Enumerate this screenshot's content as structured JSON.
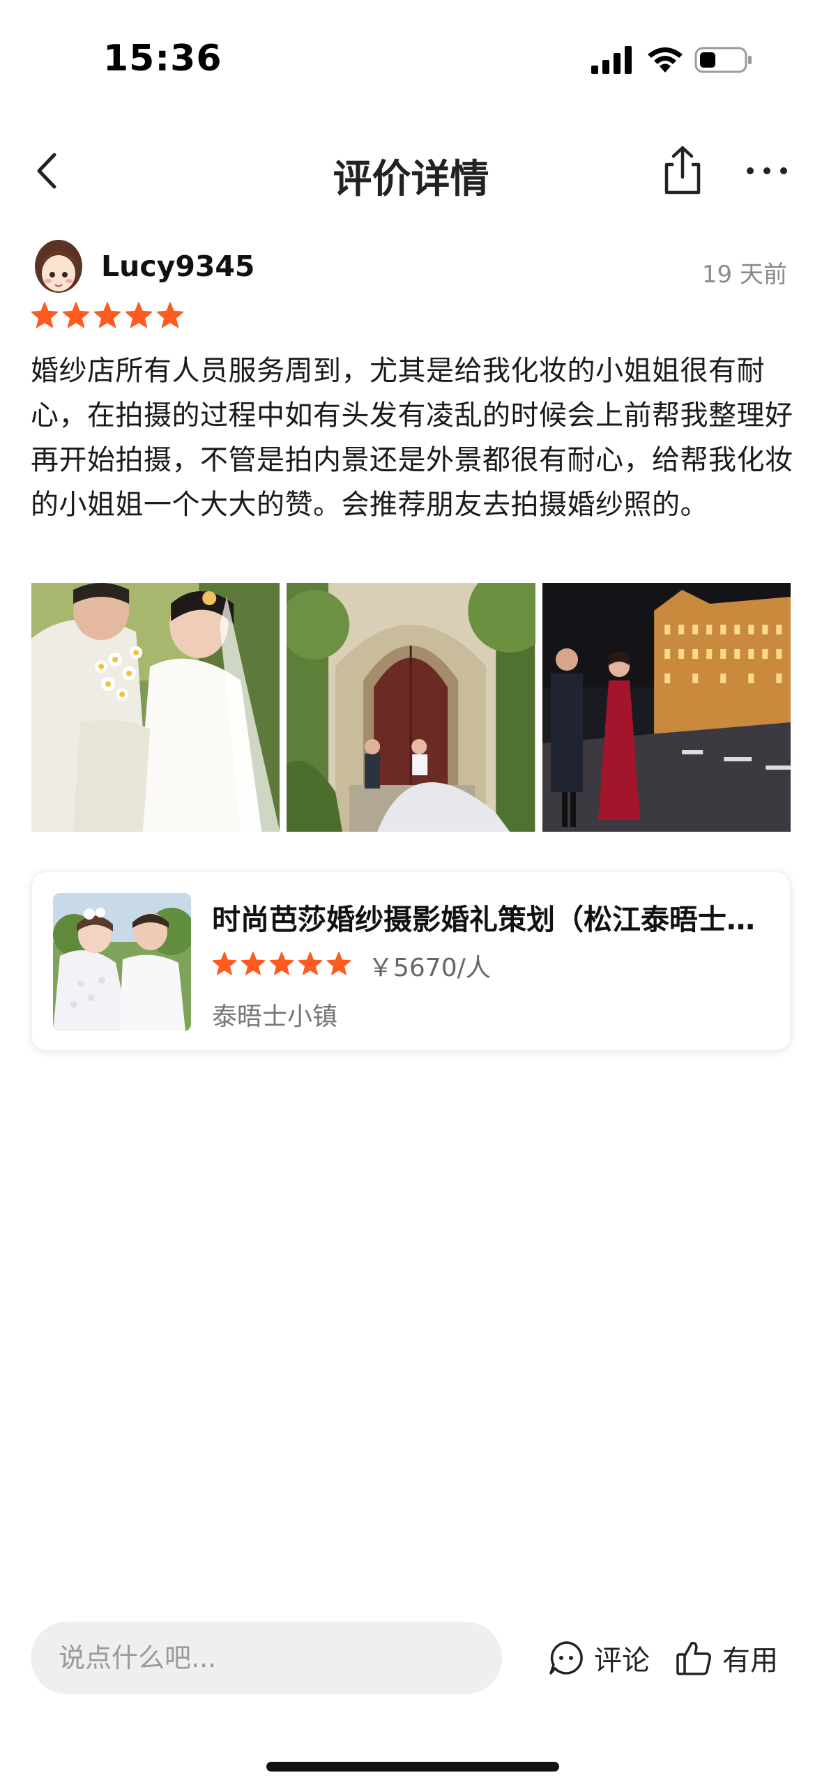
{
  "status_bar": {
    "time": "15:36",
    "icons": [
      "signal-icon",
      "wifi-icon",
      "battery-icon"
    ]
  },
  "nav": {
    "title": "评价详情",
    "back_icon": "chevron-left-icon",
    "share_icon": "share-icon",
    "more_icon": "more-icon"
  },
  "review": {
    "username": "Lucy9345",
    "time_ago": "19 天前",
    "rating": 5,
    "text": "婚纱店所有人员服务周到，尤其是给我化妆的小姐姐很有耐心，在拍摄的过程中如有头发有凌乱的时候会上前帮我整理好再开始拍摄，不管是拍内景还是外景都很有耐心，给帮我化妆的小姐姐一个大大的赞。会推荐朋友去拍摄婚纱照的。",
    "photos": [
      "wedding-photo-couple-flowers",
      "wedding-photo-church-door",
      "wedding-photo-night-street"
    ]
  },
  "product": {
    "title": "时尚芭莎婚纱摄影婚礼策划（松江泰晤士小镇店）",
    "rating": 5,
    "price": "￥5670/人",
    "location": "泰晤士小镇"
  },
  "bottom_bar": {
    "comment_placeholder": "说点什么吧...",
    "comment_label": "评论",
    "useful_label": "有用"
  },
  "colors": {
    "star": "#FF5A1F",
    "text_primary": "#111111",
    "text_secondary": "#8a8a8a",
    "input_bg": "#efefef"
  }
}
